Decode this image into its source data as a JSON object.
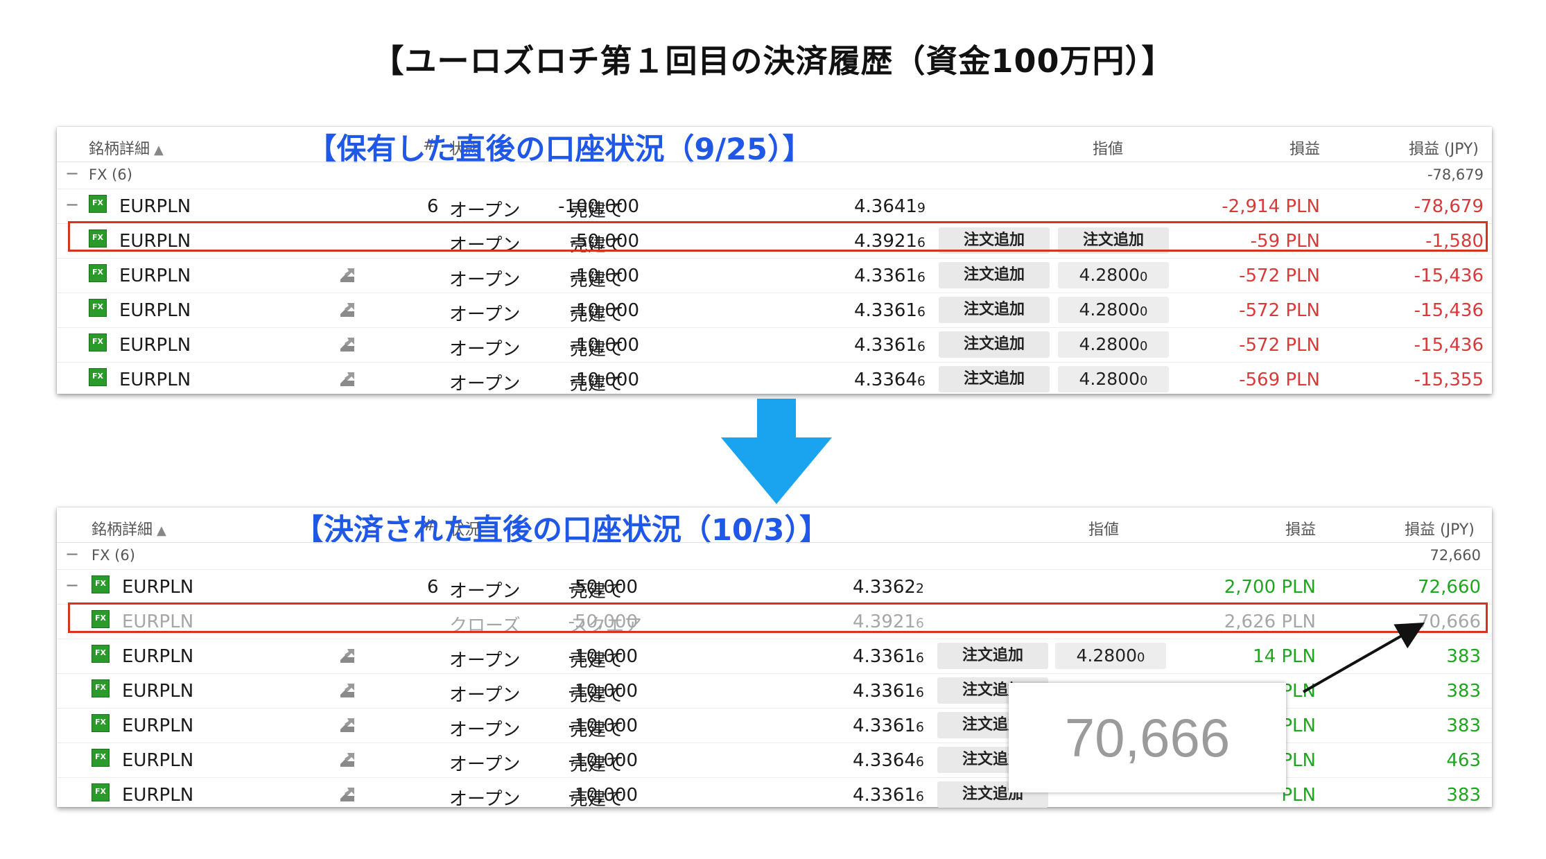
{
  "main_title": "【ユーロズロチ第１回目の決済履歴（資金100万円）】",
  "colors": {
    "title_blue": "#1f57e6",
    "highlight_red": "#d9331f",
    "loss": "#d83a3a",
    "profit": "#1fa61f",
    "arrow_blue": "#1aa3ee"
  },
  "top": {
    "overlay_title": "【保有した直後の口座状況（9/25）】",
    "headers": {
      "symbol": "銘柄詳細",
      "sort": "▲",
      "hash": "#",
      "status": "状態",
      "limit": "指値",
      "pl": "損益",
      "pl_jpy": "損益 (JPY)"
    },
    "group": {
      "label": "FX (6)",
      "pl_jpy": "-78,679"
    },
    "parent": {
      "symbol": "EURPLN",
      "count": "6",
      "status": "オープン",
      "side": "売建て",
      "qty": "-100,000",
      "rate": "4.3641",
      "rate_small": "9",
      "pl": "-2,914 PLN",
      "pl_jpy": "-78,679"
    },
    "rows": [
      {
        "symbol": "EURPLN",
        "status": "オープン",
        "side": "売建て",
        "qty": "-50,000",
        "rate": "4.3921",
        "rate_small": "6",
        "order": "注文追加",
        "limit": "注文追加",
        "limit_small": "",
        "pl": "-59 PLN",
        "pl_jpy": "-1,580"
      },
      {
        "symbol": "EURPLN",
        "status": "オープン",
        "side": "売建て",
        "qty": "-10,000",
        "rate": "4.3361",
        "rate_small": "6",
        "order": "注文追加",
        "limit": "4.2800",
        "limit_small": "0",
        "pl": "-572 PLN",
        "pl_jpy": "-15,436"
      },
      {
        "symbol": "EURPLN",
        "status": "オープン",
        "side": "売建て",
        "qty": "-10,000",
        "rate": "4.3361",
        "rate_small": "6",
        "order": "注文追加",
        "limit": "4.2800",
        "limit_small": "0",
        "pl": "-572 PLN",
        "pl_jpy": "-15,436"
      },
      {
        "symbol": "EURPLN",
        "status": "オープン",
        "side": "売建て",
        "qty": "-10,000",
        "rate": "4.3361",
        "rate_small": "6",
        "order": "注文追加",
        "limit": "4.2800",
        "limit_small": "0",
        "pl": "-572 PLN",
        "pl_jpy": "-15,436"
      },
      {
        "symbol": "EURPLN",
        "status": "オープン",
        "side": "売建て",
        "qty": "-10,000",
        "rate": "4.3364",
        "rate_small": "6",
        "order": "注文追加",
        "limit": "4.2800",
        "limit_small": "0",
        "pl": "-569 PLN",
        "pl_jpy": "-15,355"
      }
    ]
  },
  "bottom": {
    "overlay_title": "【決済された直後の口座状況（10/3）】",
    "headers": {
      "symbol": "銘柄詳細",
      "sort": "▲",
      "hash": "#",
      "status": "状況",
      "limit": "指値",
      "pl": "損益",
      "pl_jpy": "損益 (JPY)"
    },
    "group": {
      "label": "FX (6)",
      "pl_jpy": "72,660"
    },
    "parent": {
      "symbol": "EURPLN",
      "count": "6",
      "status": "オープン",
      "side": "売建て",
      "qty": "-50,000",
      "rate": "4.3362",
      "rate_small": "2",
      "pl": "2,700 PLN",
      "pl_jpy": "72,660"
    },
    "closed": {
      "symbol": "EURPLN",
      "status": "クローズ",
      "side": "スクエア",
      "qty": "-50,000",
      "rate": "4.3921",
      "rate_small": "6",
      "pl": "2,626 PLN",
      "pl_jpy": "70,666"
    },
    "rows": [
      {
        "symbol": "EURPLN",
        "status": "オープン",
        "side": "売建て",
        "qty": "-10,000",
        "rate": "4.3361",
        "rate_small": "6",
        "order": "注文追加",
        "limit": "4.2800",
        "limit_small": "0",
        "pl": "14 PLN",
        "pl_jpy": "383"
      },
      {
        "symbol": "EURPLN",
        "status": "オープン",
        "side": "売建て",
        "qty": "-10,000",
        "rate": "4.3361",
        "rate_small": "6",
        "order": "注文追加",
        "limit": "",
        "limit_small": "",
        "pl": "PLN",
        "pl_jpy": "383"
      },
      {
        "symbol": "EURPLN",
        "status": "オープン",
        "side": "売建て",
        "qty": "-10,000",
        "rate": "4.3361",
        "rate_small": "6",
        "order": "注文追加",
        "limit": "",
        "limit_small": "",
        "pl": "PLN",
        "pl_jpy": "383"
      },
      {
        "symbol": "EURPLN",
        "status": "オープン",
        "side": "売建て",
        "qty": "-10,000",
        "rate": "4.3364",
        "rate_small": "6",
        "order": "注文追加",
        "limit": "",
        "limit_small": "",
        "pl": "PLN",
        "pl_jpy": "463"
      },
      {
        "symbol": "EURPLN",
        "status": "オープン",
        "side": "売建て",
        "qty": "-10,000",
        "rate": "4.3361",
        "rate_small": "6",
        "order": "注文追加",
        "limit": "",
        "limit_small": "",
        "pl": "PLN",
        "pl_jpy": "383"
      }
    ]
  },
  "zoom_value": "70,666",
  "fx_icon_label": "FX"
}
